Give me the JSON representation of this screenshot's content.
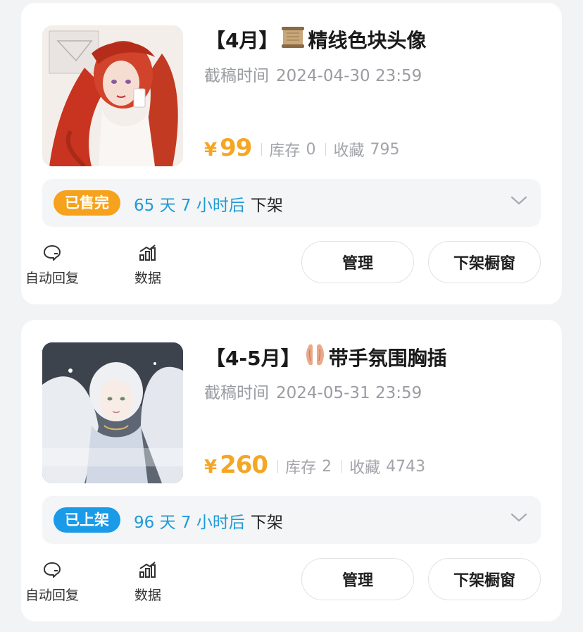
{
  "colors": {
    "price": "#f5a623",
    "badge_sold": "#f6a21c",
    "badge_on": "#1a9be8",
    "countdown": "#1f9bd6",
    "background": "#f2f3f5"
  },
  "items": [
    {
      "title_prefix": "【4月】",
      "title_emoji_icon": "scroll-icon",
      "title_text": "精线色块头像",
      "deadline_label": "截稿时间",
      "deadline_value": "2024-04-30 23:59",
      "yen": "¥",
      "price": "99",
      "stock_label": "库存",
      "stock_value": "0",
      "fav_label": "收藏",
      "fav_value": "795",
      "status_badge": "已售完",
      "status_type": "sold",
      "countdown": "65 天 7 小时后",
      "countdown_suffix": "下架",
      "tools": [
        {
          "label": "自动回复",
          "icon": "chat-reply-icon"
        },
        {
          "label": "数据",
          "icon": "bar-chart-icon"
        }
      ],
      "buttons": {
        "manage": "管理",
        "takedown": "下架橱窗"
      },
      "thumbnail_icon": "red-hair-portrait-thumbnail"
    },
    {
      "title_prefix": "【4-5月】",
      "title_emoji_icon": "ear-icon",
      "title_text": "带手氛围胸插",
      "deadline_label": "截稿时间",
      "deadline_value": "2024-05-31 23:59",
      "yen": "¥",
      "price": "260",
      "stock_label": "库存",
      "stock_value": "2",
      "fav_label": "收藏",
      "fav_value": "4743",
      "status_badge": "已上架",
      "status_type": "on",
      "countdown": "96 天 7 小时后",
      "countdown_suffix": "下架",
      "tools": [
        {
          "label": "自动回复",
          "icon": "chat-reply-icon"
        },
        {
          "label": "数据",
          "icon": "bar-chart-icon"
        }
      ],
      "buttons": {
        "manage": "管理",
        "takedown": "下架橱窗"
      },
      "thumbnail_icon": "white-hair-angel-thumbnail"
    }
  ]
}
